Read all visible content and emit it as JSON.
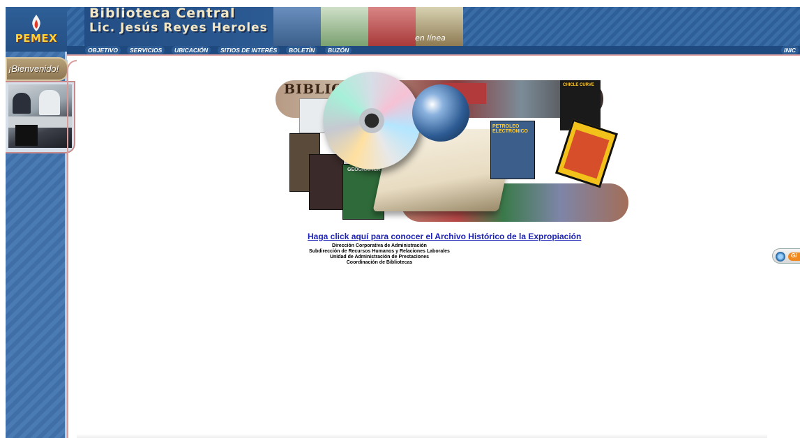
{
  "header": {
    "brand": "PEMEX",
    "title_line1": "Biblioteca Central",
    "title_line2": "Lic. Jesús Reyes Heroles",
    "tagline": "en línea"
  },
  "nav": {
    "items": [
      {
        "label": "OBJETIVO"
      },
      {
        "label": "SERVICIOS"
      },
      {
        "label": "UBICACIÓN"
      },
      {
        "label": "SITIOS DE INTERÉS"
      },
      {
        "label": "BOLETÍN"
      },
      {
        "label": "BUZÓN"
      }
    ],
    "right_label": "INIC"
  },
  "sidebar": {
    "welcome": "¡Bienvenido!"
  },
  "collage": {
    "biblio_word": "BIBLIO",
    "petroleo_label": "PETROLEO ELECTRONICO",
    "green_mag_label": "GEOGRAFICA",
    "dark_mag_label": "CHICLE CURVE"
  },
  "main": {
    "archivo_link": "Haga click aquí para conocer el Archivo Histórico de la Expropiación",
    "credits": [
      "Dirección Corporativa de Administración",
      "Subdirección de Recursos Humanos y Relaciones Laborales",
      "Unidad de Administración de Prestaciones",
      "Coordinación de Bibliotecas"
    ]
  },
  "side_badge": {
    "label": "Gi"
  },
  "colors": {
    "header_blue": "#2f5f99",
    "nav_blue": "#1e4a80",
    "link_blue": "#1c22b8",
    "accent_gold": "#ffd23a",
    "accent_rose": "#d99a9a"
  }
}
